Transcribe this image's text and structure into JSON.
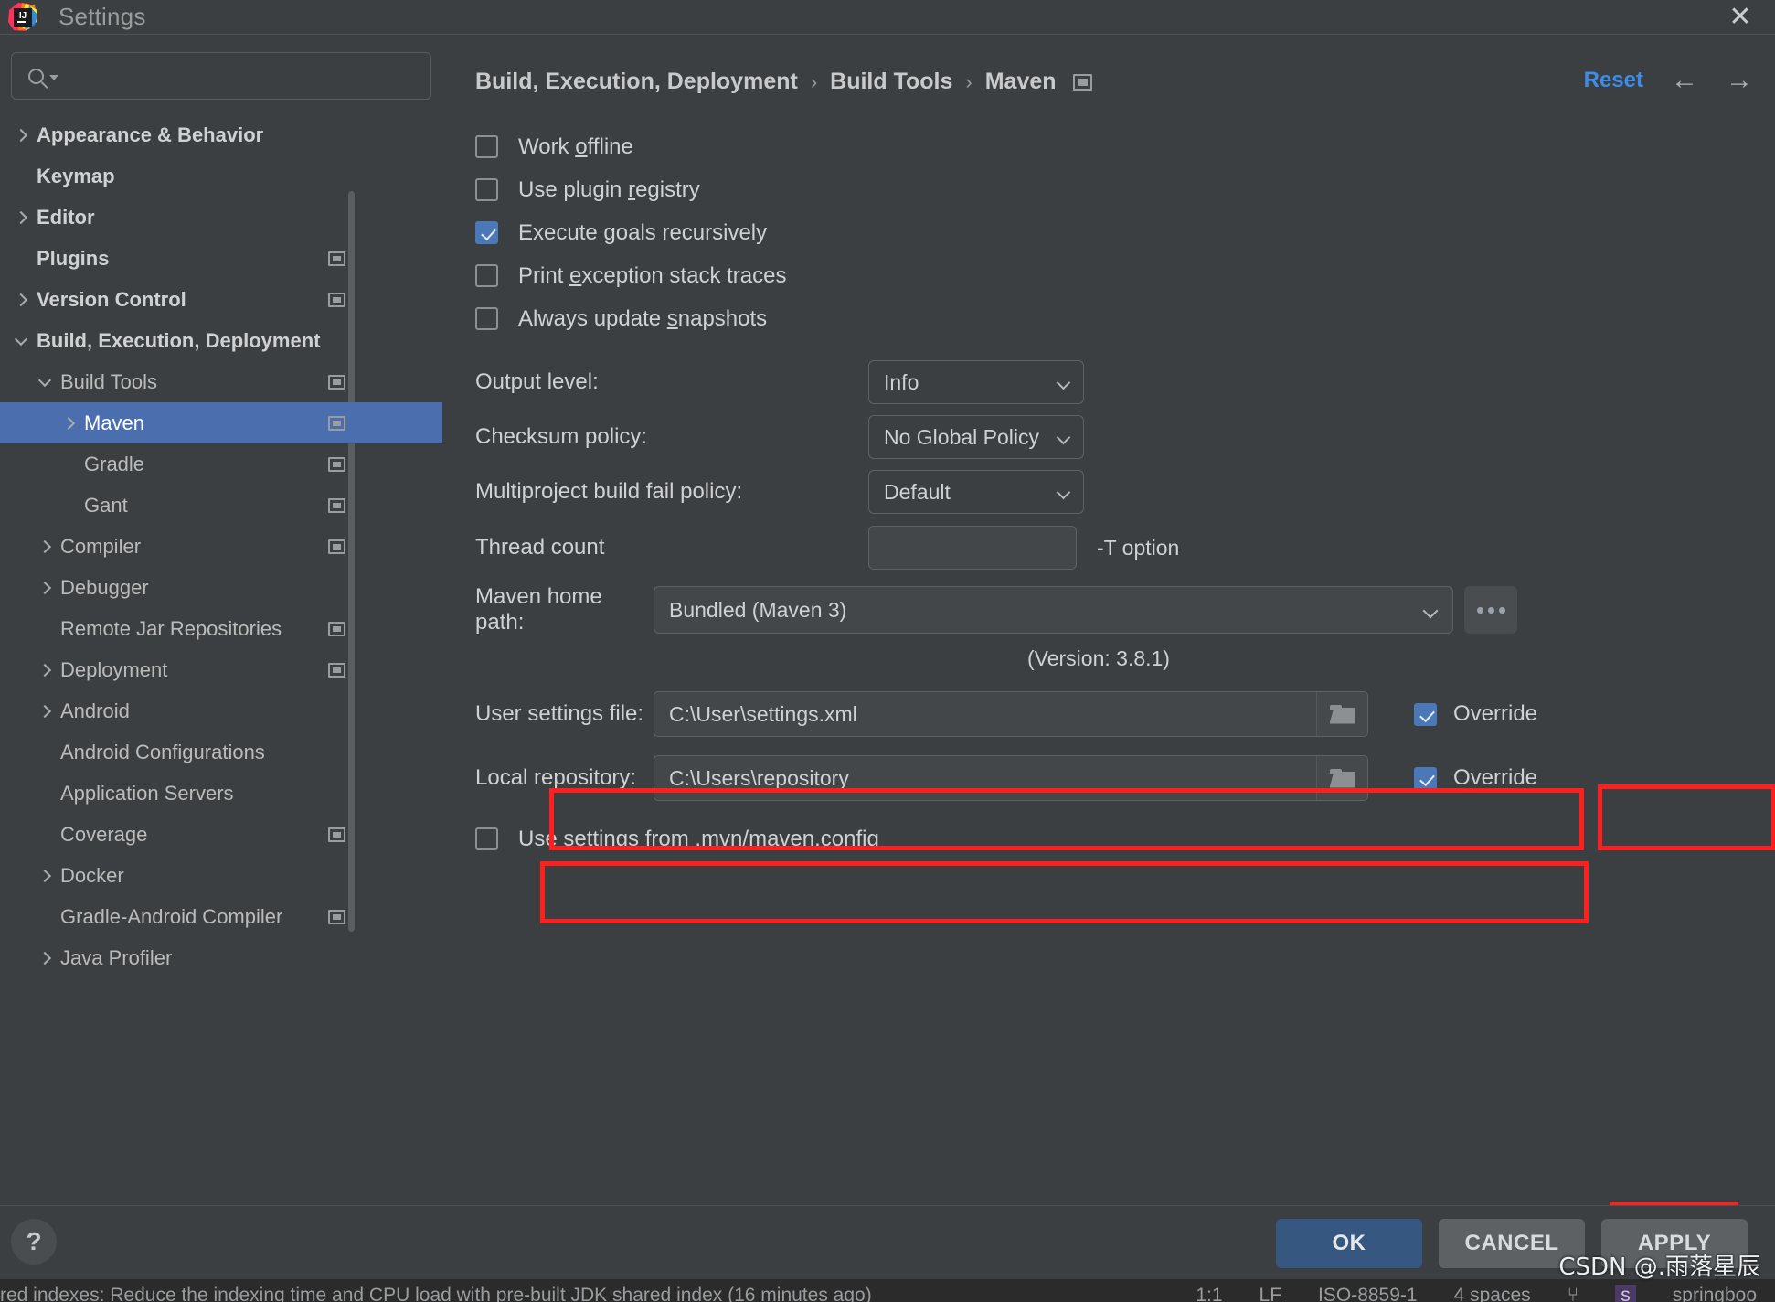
{
  "window": {
    "title": "Settings",
    "logo_text": "IJ",
    "close_icon": "✕"
  },
  "search": {
    "value": "",
    "placeholder": ""
  },
  "sidebar": {
    "items": [
      {
        "label": "Appearance & Behavior",
        "twisty": "right",
        "indent": 0,
        "bold": true,
        "config_icon": false,
        "selected": false
      },
      {
        "label": "Keymap",
        "twisty": "none",
        "indent": 0,
        "bold": true,
        "config_icon": false,
        "selected": false
      },
      {
        "label": "Editor",
        "twisty": "right",
        "indent": 0,
        "bold": true,
        "config_icon": false,
        "selected": false
      },
      {
        "label": "Plugins",
        "twisty": "none",
        "indent": 0,
        "bold": true,
        "config_icon": true,
        "selected": false
      },
      {
        "label": "Version Control",
        "twisty": "right",
        "indent": 0,
        "bold": true,
        "config_icon": true,
        "selected": false
      },
      {
        "label": "Build, Execution, Deployment",
        "twisty": "down",
        "indent": 0,
        "bold": true,
        "config_icon": false,
        "selected": false
      },
      {
        "label": "Build Tools",
        "twisty": "down",
        "indent": 1,
        "bold": false,
        "config_icon": true,
        "selected": false
      },
      {
        "label": "Maven",
        "twisty": "right",
        "indent": 2,
        "bold": false,
        "config_icon": true,
        "selected": true
      },
      {
        "label": "Gradle",
        "twisty": "none",
        "indent": 2,
        "bold": false,
        "config_icon": true,
        "selected": false
      },
      {
        "label": "Gant",
        "twisty": "none",
        "indent": 2,
        "bold": false,
        "config_icon": true,
        "selected": false
      },
      {
        "label": "Compiler",
        "twisty": "right",
        "indent": 1,
        "bold": false,
        "config_icon": true,
        "selected": false
      },
      {
        "label": "Debugger",
        "twisty": "right",
        "indent": 1,
        "bold": false,
        "config_icon": false,
        "selected": false
      },
      {
        "label": "Remote Jar Repositories",
        "twisty": "none",
        "indent": 1,
        "bold": false,
        "config_icon": true,
        "selected": false
      },
      {
        "label": "Deployment",
        "twisty": "right",
        "indent": 1,
        "bold": false,
        "config_icon": true,
        "selected": false
      },
      {
        "label": "Android",
        "twisty": "right",
        "indent": 1,
        "bold": false,
        "config_icon": false,
        "selected": false
      },
      {
        "label": "Android Configurations",
        "twisty": "none",
        "indent": 1,
        "bold": false,
        "config_icon": false,
        "selected": false
      },
      {
        "label": "Application Servers",
        "twisty": "none",
        "indent": 1,
        "bold": false,
        "config_icon": false,
        "selected": false
      },
      {
        "label": "Coverage",
        "twisty": "none",
        "indent": 1,
        "bold": false,
        "config_icon": true,
        "selected": false
      },
      {
        "label": "Docker",
        "twisty": "right",
        "indent": 1,
        "bold": false,
        "config_icon": false,
        "selected": false
      },
      {
        "label": "Gradle-Android Compiler",
        "twisty": "none",
        "indent": 1,
        "bold": false,
        "config_icon": true,
        "selected": false
      },
      {
        "label": "Java Profiler",
        "twisty": "right",
        "indent": 1,
        "bold": false,
        "config_icon": false,
        "selected": false
      }
    ]
  },
  "header": {
    "breadcrumb": [
      "Build, Execution, Deployment",
      "Build Tools",
      "Maven"
    ],
    "separator": "›",
    "reset_label": "Reset",
    "back_arrow": "←",
    "forward_arrow": "→"
  },
  "form": {
    "checkboxes": [
      {
        "label_before": "Work ",
        "mnemonic": "o",
        "label_after": "ffline",
        "checked": false
      },
      {
        "label_before": "Use plugin ",
        "mnemonic": "r",
        "label_after": "egistry",
        "checked": false
      },
      {
        "label_before": "Execute ",
        "mnemonic": "g",
        "label_after": "oals recursively",
        "checked": true
      },
      {
        "label_before": "Print ",
        "mnemonic": "e",
        "label_after": "xception stack traces",
        "checked": false
      },
      {
        "label_before": "Always update ",
        "mnemonic": "s",
        "label_after": "napshots",
        "checked": false
      }
    ],
    "output_level": {
      "label": "Output level:",
      "value": "Info"
    },
    "checksum_policy": {
      "label": "Checksum policy:",
      "value": "No Global Policy"
    },
    "multiproject_policy": {
      "label": "Multiproject build fail policy:",
      "value": "Default"
    },
    "thread_count": {
      "label": "Thread count",
      "value": "",
      "hint": "-T option"
    },
    "maven_home": {
      "label": "Maven home path:",
      "value": "Bundled (Maven 3)",
      "browse_label": "...",
      "version_note": "(Version: 3.8.1)"
    },
    "user_settings_file": {
      "label": "User settings file:",
      "value": "C:\\User\\settings.xml",
      "override_label": "Override",
      "override_checked": true
    },
    "local_repository": {
      "label": "Local repository:",
      "value": "C:\\Users\\repository",
      "override_label": "Override",
      "override_checked": true
    },
    "mvn_config": {
      "label": "Use settings from .mvn/maven.config",
      "checked": false
    }
  },
  "footer": {
    "help_label": "?",
    "ok_label": "OK",
    "cancel_label": "CANCEL",
    "apply_label": "APPLY"
  },
  "background_status": {
    "left_text": "red indexes: Reduce the indexing time and CPU load with pre-built JDK shared index   (16 minutes ago)",
    "caret": "1:1",
    "line_sep": "LF",
    "encoding": "ISO-8859-1",
    "indent": "4 spaces",
    "branch_icon": "⑂",
    "chip": "s",
    "chip_text": "springboo"
  },
  "watermark": "CSDN @.雨落星辰",
  "colors": {
    "accent_blue": "#4b6eaf",
    "link_blue": "#3d8ce8",
    "checkbox_blue": "#4b79b8",
    "ok_button": "#365880",
    "highlight_red": "#ff1f1f",
    "panel_bg": "#3c3f41"
  }
}
